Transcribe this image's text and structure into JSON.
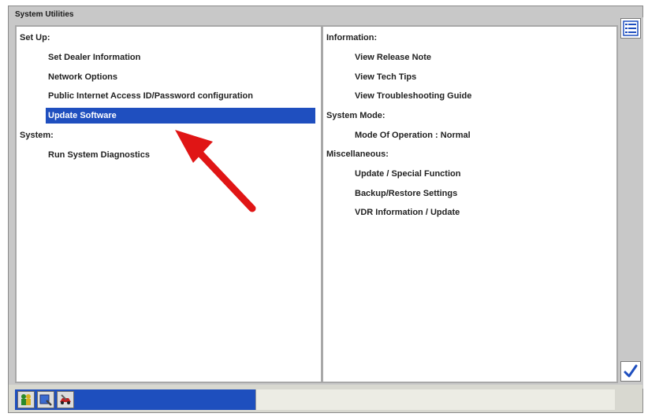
{
  "window": {
    "title": "System Utilities"
  },
  "left": {
    "setup_header": "Set Up:",
    "setup_items": [
      "Set Dealer Information",
      "Network Options",
      "Public Internet Access ID/Password configuration",
      "Update Software"
    ],
    "selected_index": 3,
    "system_header": "System:",
    "system_items": [
      "Run System Diagnostics"
    ]
  },
  "right": {
    "information_header": "Information:",
    "information_items": [
      "View Release Note",
      "View Tech Tips",
      "View Troubleshooting Guide"
    ],
    "system_mode_header": "System Mode:",
    "system_mode_items": [
      "Mode Of Operation : Normal"
    ],
    "misc_header": "Miscellaneous:",
    "misc_items": [
      "Update / Special Function",
      "Backup/Restore Settings",
      "VDR Information / Update"
    ]
  },
  "icons": {
    "list": "list-icon",
    "check": "checkmark-icon",
    "taskbar": [
      "people-icon",
      "scan-tool-icon",
      "car-tool-icon"
    ]
  },
  "colors": {
    "selection": "#1f4fbf",
    "annotation_arrow": "#e01515",
    "taskbar_accent": "#1e4fbe"
  }
}
